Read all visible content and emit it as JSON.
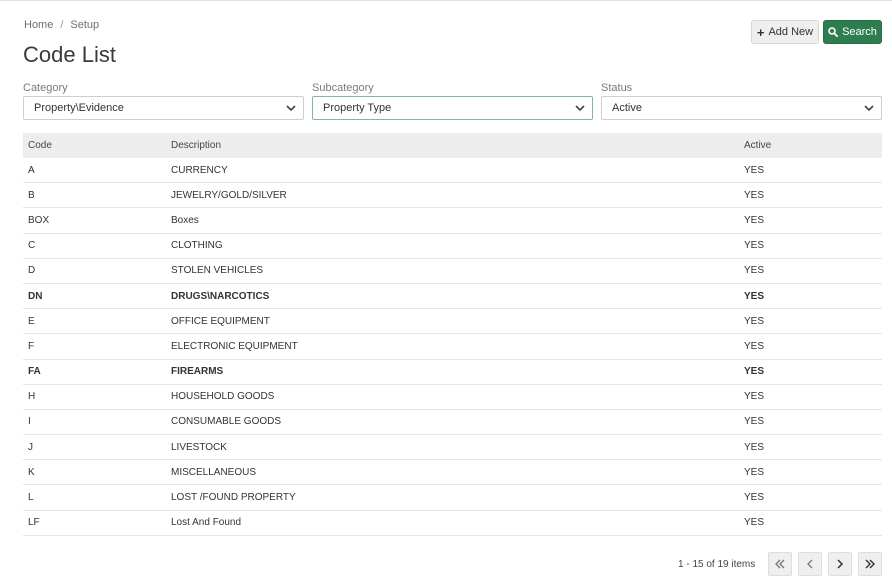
{
  "breadcrumb": {
    "home": "Home",
    "separator": "/",
    "current": "Setup"
  },
  "page": {
    "title": "Code List"
  },
  "actions": {
    "add_new": "Add New",
    "search": "Search",
    "add_icon": "plus-icon",
    "search_icon": "search-icon"
  },
  "filters": {
    "category": {
      "label": "Category",
      "value": "Property\\Evidence"
    },
    "subcategory": {
      "label": "Subcategory",
      "value": "Property Type"
    },
    "status": {
      "label": "Status",
      "value": "Active"
    }
  },
  "grid": {
    "columns": [
      "Code",
      "Description",
      "Active"
    ],
    "rows": [
      {
        "code": "A",
        "description": "CURRENCY",
        "active": "YES",
        "bold": false
      },
      {
        "code": "B",
        "description": "JEWELRY/GOLD/SILVER",
        "active": "YES",
        "bold": false
      },
      {
        "code": "BOX",
        "description": "Boxes",
        "active": "YES",
        "bold": false
      },
      {
        "code": "C",
        "description": "CLOTHING",
        "active": "YES",
        "bold": false
      },
      {
        "code": "D",
        "description": "STOLEN VEHICLES",
        "active": "YES",
        "bold": false
      },
      {
        "code": "DN",
        "description": "DRUGS\\NARCOTICS",
        "active": "YES",
        "bold": true
      },
      {
        "code": "E",
        "description": "OFFICE EQUIPMENT",
        "active": "YES",
        "bold": false
      },
      {
        "code": "F",
        "description": "ELECTRONIC EQUIPMENT",
        "active": "YES",
        "bold": false
      },
      {
        "code": "FA",
        "description": "FIREARMS",
        "active": "YES",
        "bold": true
      },
      {
        "code": "H",
        "description": "HOUSEHOLD GOODS",
        "active": "YES",
        "bold": false
      },
      {
        "code": "I",
        "description": "CONSUMABLE GOODS",
        "active": "YES",
        "bold": false
      },
      {
        "code": "J",
        "description": "LIVESTOCK",
        "active": "YES",
        "bold": false
      },
      {
        "code": "K",
        "description": "MISCELLANEOUS",
        "active": "YES",
        "bold": false
      },
      {
        "code": "L",
        "description": "LOST /FOUND PROPERTY",
        "active": "YES",
        "bold": false
      },
      {
        "code": "LF",
        "description": "Lost And Found",
        "active": "YES",
        "bold": false
      }
    ]
  },
  "pager": {
    "info": "1 - 15 of 19 items"
  },
  "colors": {
    "primary": "#2e7d4f",
    "header_bg": "#ededed",
    "focus_border": "#7fb89a"
  }
}
